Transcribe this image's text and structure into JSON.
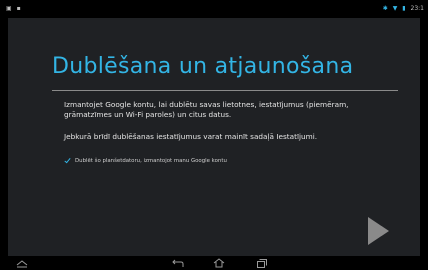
{
  "status_bar": {
    "left_icons": [
      "screenshot-icon",
      "notification-icon"
    ],
    "right_icons": [
      "bluetooth-icon",
      "wifi-icon",
      "battery-icon"
    ],
    "time": "23:1"
  },
  "setup": {
    "title": "Dublēšana un atjaunošana",
    "paragraph1": "Izmantojet Google kontu, lai dublētu savas lietotnes, iestatījumus (piemēram, grāmatzīmes un Wi-Fi paroles) un citus datus.",
    "paragraph2": "Jebkurā brīdī dublēšanas iestatījumus varat mainīt sadaļā Iestatījumi.",
    "checkbox_label": "Dublēt šo planšetdatoru, izmantojot manu Google kontu",
    "checkbox_checked": true
  },
  "navigation": {
    "buttons": [
      "menu-icon",
      "back-icon",
      "home-icon",
      "recent-apps-icon"
    ]
  },
  "colors": {
    "accent": "#33b5e5",
    "panel": "#1f2124",
    "background": "#000000"
  }
}
